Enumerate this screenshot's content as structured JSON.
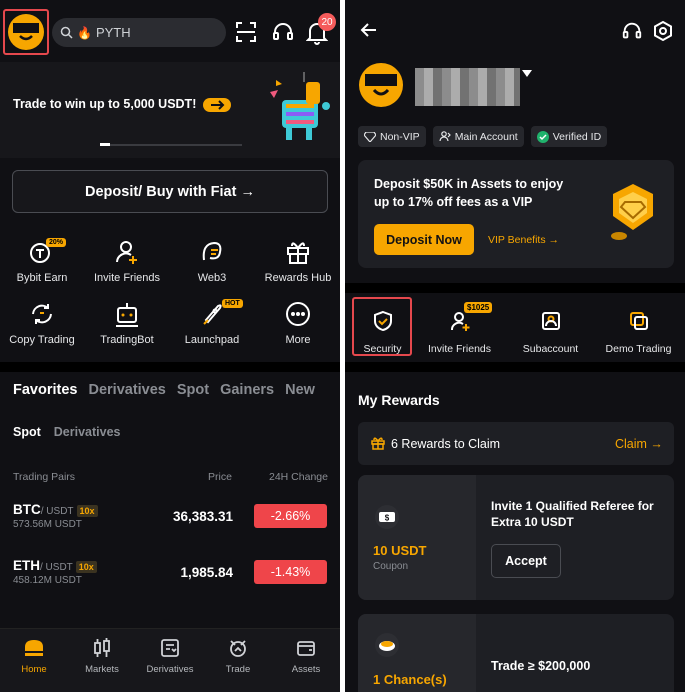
{
  "left": {
    "search": {
      "value": "PYTH"
    },
    "notifications": {
      "count": "20"
    },
    "banner": {
      "text": "Trade to win up to 5,000 USDT!",
      "progress": 0.07
    },
    "deposit_button": "Deposit/ Buy with Fiat →",
    "shortcuts": [
      {
        "label": "Bybit Earn",
        "icon": "earn-icon",
        "tag": "20%"
      },
      {
        "label": "Invite Friends",
        "icon": "invite-friends-icon"
      },
      {
        "label": "Web3",
        "icon": "web3-icon"
      },
      {
        "label": "Rewards Hub",
        "icon": "gift-icon"
      },
      {
        "label": "Copy Trading",
        "icon": "copy-trading-icon"
      },
      {
        "label": "TradingBot",
        "icon": "trading-bot-icon"
      },
      {
        "label": "Launchpad",
        "icon": "launchpad-icon",
        "tag": "HOT"
      },
      {
        "label": "More",
        "icon": "more-icon"
      }
    ],
    "market_tabs": [
      "Favorites",
      "Derivatives",
      "Spot",
      "Gainers",
      "New"
    ],
    "market_active": "Favorites",
    "sub_tabs": [
      "Spot",
      "Derivatives"
    ],
    "columns": {
      "pairs": "Trading Pairs",
      "price": "Price",
      "change": "24H Change"
    },
    "rows": [
      {
        "base": "BTC",
        "quote": "/ USDT",
        "leverage": "10x",
        "volume": "573.56M USDT",
        "price": "36,383.31",
        "change": "-2.66%"
      },
      {
        "base": "ETH",
        "quote": "/ USDT",
        "leverage": "10x",
        "volume": "458.12M USDT",
        "price": "1,985.84",
        "change": "-1.43%"
      }
    ],
    "nav": [
      {
        "label": "Home",
        "icon": "home-icon",
        "active": true
      },
      {
        "label": "Markets",
        "icon": "markets-icon"
      },
      {
        "label": "Derivatives",
        "icon": "derivatives-icon"
      },
      {
        "label": "Trade",
        "icon": "trade-icon"
      },
      {
        "label": "Assets",
        "icon": "wallet-icon"
      }
    ]
  },
  "right": {
    "chips": [
      {
        "label": "Non-VIP",
        "icon": "diamond-icon"
      },
      {
        "label": "Main Account",
        "icon": "account-icon"
      },
      {
        "label": "Verified ID",
        "icon": "verified-icon"
      }
    ],
    "vip_card": {
      "text": "Deposit $50K in Assets to enjoy up to 17% off fees as a VIP",
      "button": "Deposit Now",
      "link": "VIP Benefits →"
    },
    "quick_actions": [
      {
        "label": "Security",
        "icon": "shield-icon"
      },
      {
        "label": "Invite Friends",
        "icon": "invite-friends-icon",
        "tag": "$1025"
      },
      {
        "label": "Subaccount",
        "icon": "subaccount-icon"
      },
      {
        "label": "Demo Trading",
        "icon": "demo-trading-icon"
      }
    ],
    "rewards_title": "My Rewards",
    "claim": {
      "text": "6 Rewards to Claim",
      "link": "Claim →"
    },
    "reward_cards": [
      {
        "amount": "10 USDT",
        "type": "Coupon",
        "desc": "Invite 1 Qualified Referee for Extra 10 USDT",
        "button": "Accept"
      },
      {
        "amount": "1 Chance(s)",
        "desc": "Trade ≥ $200,000"
      }
    ]
  },
  "colors": {
    "accent": "#f7a600",
    "negative": "#ef454a",
    "background": "#101014",
    "highlight": "#e5484d"
  }
}
